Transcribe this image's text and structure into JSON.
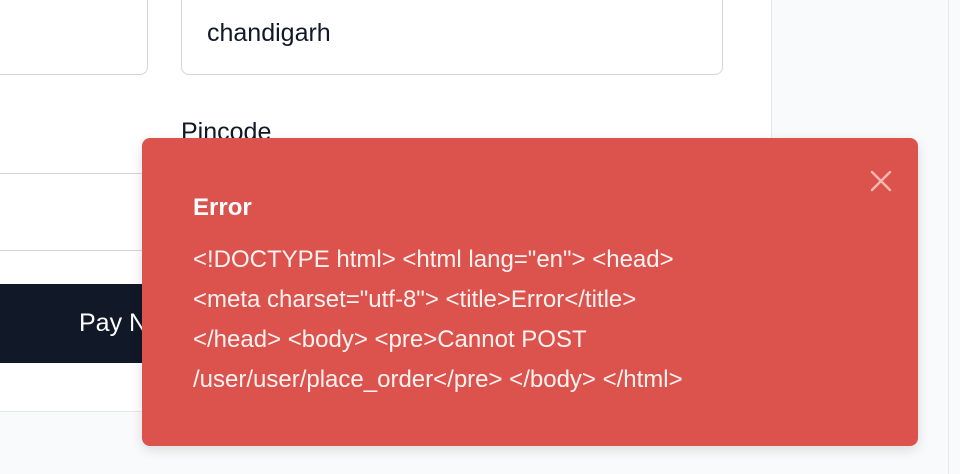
{
  "form": {
    "city_value": "chandigarh",
    "pincode_label": "Pincode",
    "pay_button_label": "Pay Now"
  },
  "toast": {
    "type": "error",
    "color": "#dc524c",
    "title": "Error",
    "message": "<!DOCTYPE html> <html lang=\"en\"> <head>\n<meta charset=\"utf-8\"> <title>Error</title>\n</head> <body> <pre>Cannot POST\n/user/user/place_order</pre> </body> </html>",
    "close_icon": "close-icon"
  }
}
